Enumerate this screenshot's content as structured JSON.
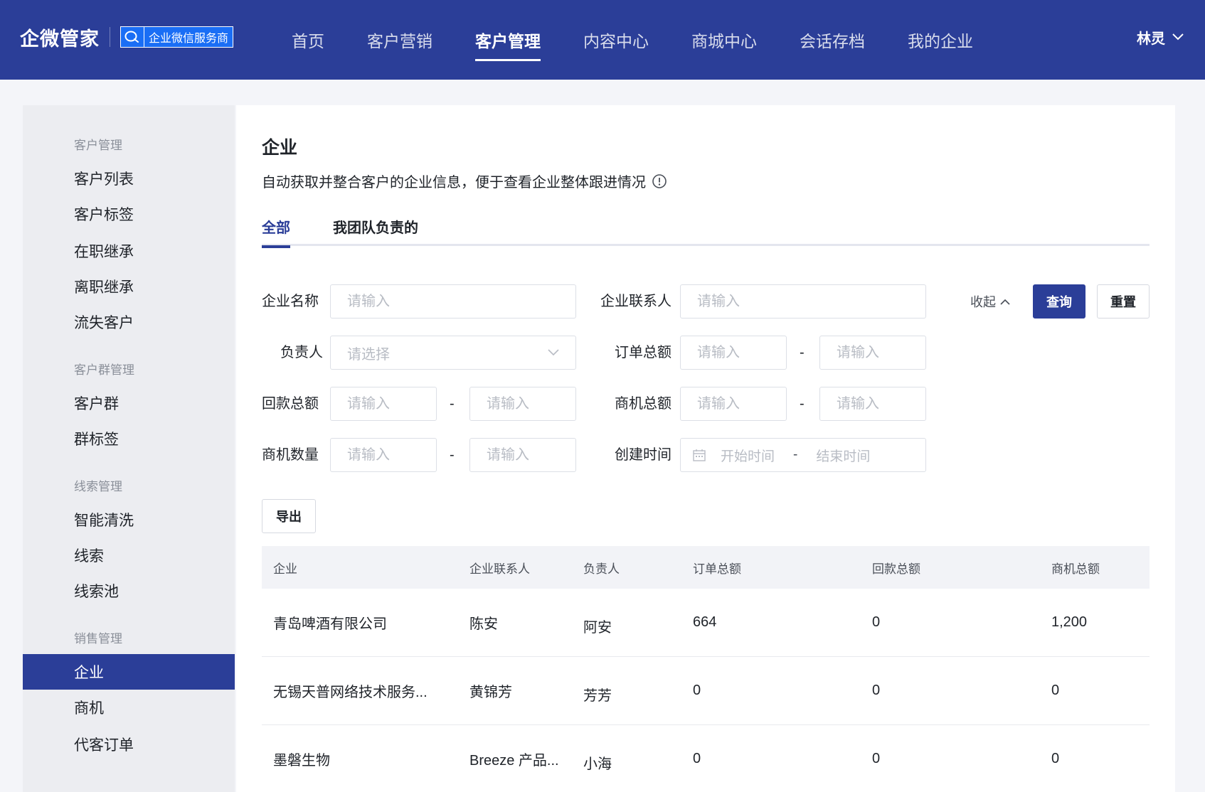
{
  "header": {
    "brand_name": "企微管家",
    "badge_text": "企业微信服务商",
    "nav": [
      {
        "label": "首页",
        "active": false
      },
      {
        "label": "客户营销",
        "active": false
      },
      {
        "label": "客户管理",
        "active": true
      },
      {
        "label": "内容中心",
        "active": false
      },
      {
        "label": "商城中心",
        "active": false
      },
      {
        "label": "会话存档",
        "active": false
      },
      {
        "label": "我的企业",
        "active": false
      }
    ],
    "user_name": "林灵"
  },
  "sidebar": {
    "groups": [
      {
        "title": "客户管理",
        "items": [
          "客户列表",
          "客户标签",
          "在职继承",
          "离职继承",
          "流失客户"
        ]
      },
      {
        "title": "客户群管理",
        "items": [
          "客户群",
          "群标签"
        ]
      },
      {
        "title": "线索管理",
        "items": [
          "智能清洗",
          "线索",
          "线索池"
        ]
      },
      {
        "title": "销售管理",
        "items": [
          "企业",
          "商机",
          "代客订单"
        ]
      }
    ],
    "active_item": "企业"
  },
  "main": {
    "title": "企业",
    "description": "自动获取并整合客户的企业信息，便于查看企业整体跟进情况",
    "tabs": [
      {
        "label": "全部",
        "active": true
      },
      {
        "label": "我团队负责的",
        "active": false
      }
    ],
    "filters": {
      "company_name_label": "企业名称",
      "company_contact_label": "企业联系人",
      "owner_label": "负责人",
      "order_total_label": "订单总额",
      "payment_total_label": "回款总额",
      "opportunity_total_label": "商机总额",
      "opportunity_count_label": "商机数量",
      "created_time_label": "创建时间",
      "input_placeholder": "请输入",
      "select_placeholder": "请选择",
      "start_time_placeholder": "开始时间",
      "end_time_placeholder": "结束时间",
      "range_separator": "-"
    },
    "actions": {
      "collapse_label": "收起",
      "query_label": "查询",
      "reset_label": "重置",
      "export_label": "导出"
    },
    "table": {
      "columns": [
        "企业",
        "企业联系人",
        "负责人",
        "订单总额",
        "回款总额",
        "商机总额"
      ],
      "rows": [
        {
          "company": "青岛啤酒有限公司",
          "contact": "陈安",
          "owner": "阿安",
          "order_total": "664",
          "payment_total": "0",
          "opportunity_total": "1,200"
        },
        {
          "company": "无锡天普网络技术服务...",
          "contact": "黄锦芳",
          "owner": "芳芳",
          "order_total": "0",
          "payment_total": "0",
          "opportunity_total": "0"
        },
        {
          "company": "墨磐生物",
          "contact": "Breeze 产品...",
          "owner": "小海",
          "order_total": "0",
          "payment_total": "0",
          "opportunity_total": "0"
        }
      ]
    }
  },
  "colors": {
    "primary": "#2b3e98",
    "page_bg": "#f4f5f9",
    "sidebar_bg": "#ecedf1"
  }
}
